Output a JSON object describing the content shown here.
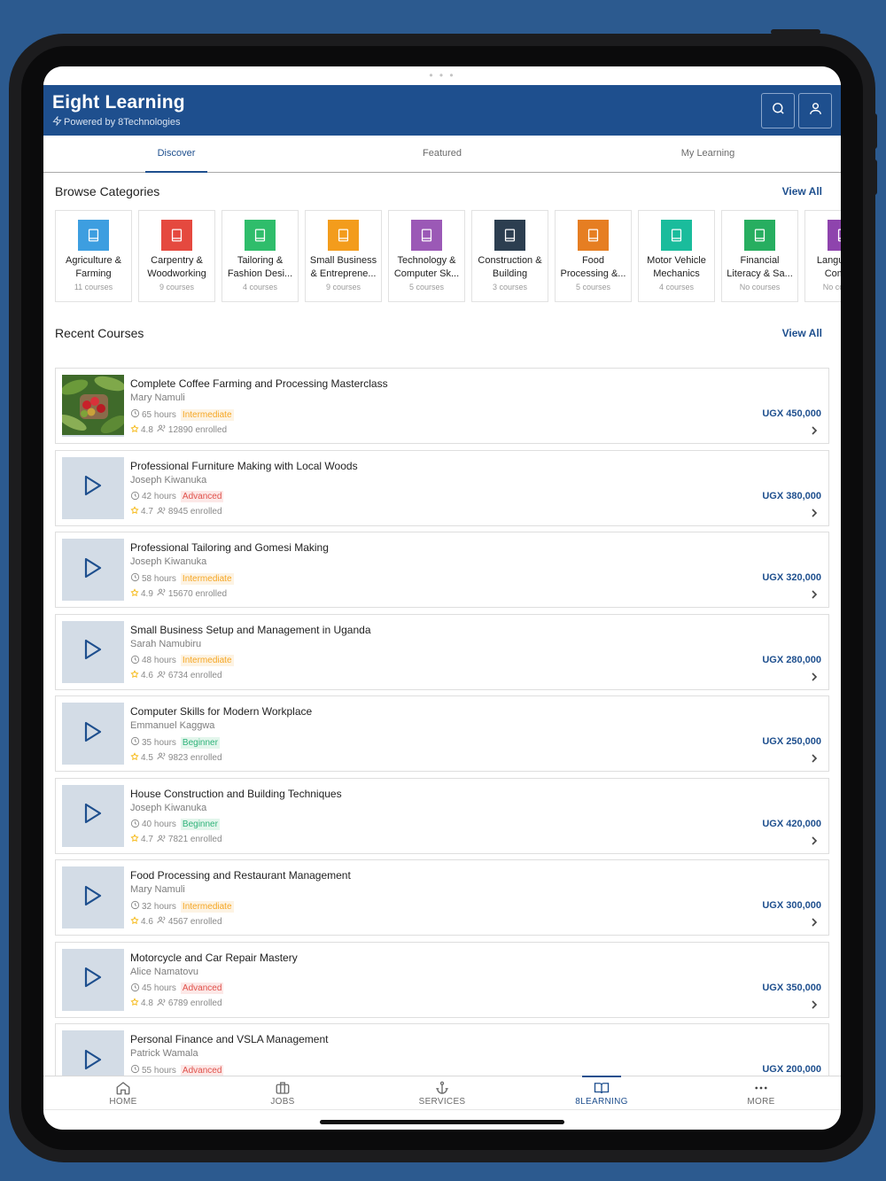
{
  "colors": {
    "brand": "#1e4f8e",
    "background": "#2c5a8f",
    "intermediate": "#f5a623",
    "advanced": "#e0504a",
    "beginner": "#2fb37a"
  },
  "app": {
    "title": "Eight Learning",
    "subtitle": "Powered by 8Technologies"
  },
  "header_buttons": {
    "search_icon": "search-icon",
    "profile_icon": "user-icon"
  },
  "tabs": [
    {
      "label": "Discover",
      "active": true
    },
    {
      "label": "Featured",
      "active": false
    },
    {
      "label": "My Learning",
      "active": false
    }
  ],
  "categories_section": {
    "title": "Browse Categories",
    "view_all": "View All"
  },
  "categories": [
    {
      "name": "Agriculture & Farming",
      "count": "11 courses",
      "color": "#3d9ee0"
    },
    {
      "name": "Carpentry & Woodworking",
      "count": "9 courses",
      "color": "#e5493f"
    },
    {
      "name": "Tailoring & Fashion Desi...",
      "count": "4 courses",
      "color": "#2fbd6b"
    },
    {
      "name": "Small Business & Entreprene...",
      "count": "9 courses",
      "color": "#f39c1c"
    },
    {
      "name": "Technology & Computer Sk...",
      "count": "5 courses",
      "color": "#9b59b6"
    },
    {
      "name": "Construction & Building",
      "count": "3 courses",
      "color": "#2c3e50"
    },
    {
      "name": "Food Processing &...",
      "count": "5 courses",
      "color": "#e67e22"
    },
    {
      "name": "Motor Vehicle Mechanics",
      "count": "4 courses",
      "color": "#1abc9c"
    },
    {
      "name": "Financial Literacy & Sa...",
      "count": "No courses",
      "color": "#27ae60"
    },
    {
      "name": "Language & Comm...",
      "count": "No courses",
      "color": "#8e44ad"
    }
  ],
  "courses_section": {
    "title": "Recent Courses",
    "view_all": "View All"
  },
  "courses": [
    {
      "title": "Complete Coffee Farming and Processing Masterclass",
      "author": "Mary Namuli",
      "hours": "65 hours",
      "level": "Intermediate",
      "rating": "4.8",
      "enrolled": "12890 enrolled",
      "price": "UGX 450,000",
      "thumb": "photo"
    },
    {
      "title": "Professional Furniture Making with Local Woods",
      "author": "Joseph Kiwanuka",
      "hours": "42 hours",
      "level": "Advanced",
      "rating": "4.7",
      "enrolled": "8945 enrolled",
      "price": "UGX 380,000",
      "thumb": "play"
    },
    {
      "title": "Professional Tailoring and Gomesi Making",
      "author": "Joseph Kiwanuka",
      "hours": "58 hours",
      "level": "Intermediate",
      "rating": "4.9",
      "enrolled": "15670 enrolled",
      "price": "UGX 320,000",
      "thumb": "play"
    },
    {
      "title": "Small Business Setup and Management in Uganda",
      "author": "Sarah Namubiru",
      "hours": "48 hours",
      "level": "Intermediate",
      "rating": "4.6",
      "enrolled": "6734 enrolled",
      "price": "UGX 280,000",
      "thumb": "play"
    },
    {
      "title": "Computer Skills for Modern Workplace",
      "author": "Emmanuel Kaggwa",
      "hours": "35 hours",
      "level": "Beginner",
      "rating": "4.5",
      "enrolled": "9823 enrolled",
      "price": "UGX 250,000",
      "thumb": "play"
    },
    {
      "title": "House Construction and Building Techniques",
      "author": "Joseph Kiwanuka",
      "hours": "40 hours",
      "level": "Beginner",
      "rating": "4.7",
      "enrolled": "7821 enrolled",
      "price": "UGX 420,000",
      "thumb": "play"
    },
    {
      "title": "Food Processing and Restaurant Management",
      "author": "Mary Namuli",
      "hours": "32 hours",
      "level": "Intermediate",
      "rating": "4.6",
      "enrolled": "4567 enrolled",
      "price": "UGX 300,000",
      "thumb": "play"
    },
    {
      "title": "Motorcycle and Car Repair Mastery",
      "author": "Alice Namatovu",
      "hours": "45 hours",
      "level": "Advanced",
      "rating": "4.8",
      "enrolled": "6789 enrolled",
      "price": "UGX 350,000",
      "thumb": "play"
    },
    {
      "title": "Personal Finance and VSLA Management",
      "author": "Patrick Wamala",
      "hours": "55 hours",
      "level": "Advanced",
      "rating": "",
      "enrolled": "",
      "price": "UGX 200,000",
      "thumb": "play"
    }
  ],
  "bottom_nav": [
    {
      "label": "HOME",
      "icon": "home-icon",
      "active": false
    },
    {
      "label": "JOBS",
      "icon": "briefcase-icon",
      "active": false
    },
    {
      "label": "SERVICES",
      "icon": "anchor-icon",
      "active": false
    },
    {
      "label": "8LEARNING",
      "icon": "book-open-icon",
      "active": true
    },
    {
      "label": "MORE",
      "icon": "more-icon",
      "active": false
    }
  ]
}
